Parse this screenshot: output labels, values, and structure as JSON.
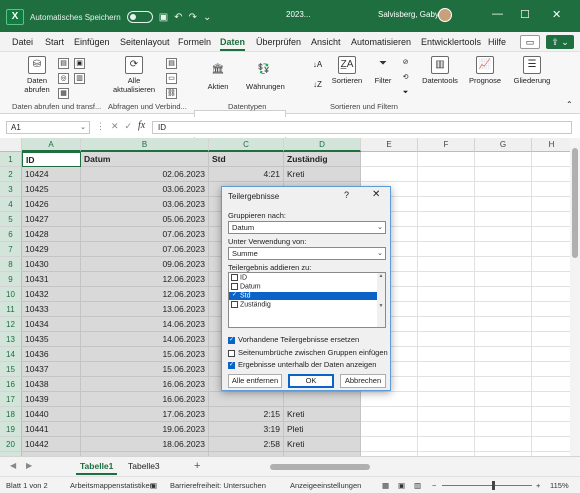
{
  "titlebar": {
    "autosave_label": "Automatisches Speichern",
    "doc_title": "2023...",
    "user_name": "Salvisberg, Gaby"
  },
  "menu": [
    "Datei",
    "Start",
    "Einfügen",
    "Seitenlayout",
    "Formeln",
    "Daten",
    "Überprüfen",
    "Ansicht",
    "Automatisieren",
    "Entwicklertools",
    "Hilfe"
  ],
  "menu_active": "Daten",
  "ribbon": {
    "daten_abrufen": "Daten abrufen",
    "alle_aktualisieren": "Alle aktualisieren",
    "aktien": "Aktien",
    "waehrungen": "Währungen",
    "sortieren": "Sortieren",
    "filter": "Filter",
    "datentools": "Datentools",
    "prognose": "Prognose",
    "gliederung": "Gliederung",
    "group_abrufen": "Daten abrufen und transf...",
    "group_abfragen": "Abfragen und Verbind...",
    "group_datentypen": "Datentypen",
    "group_sortieren": "Sortieren und Filtern"
  },
  "formula": {
    "namebox": "A1",
    "content": "ID"
  },
  "columns": [
    "A",
    "B",
    "C",
    "D",
    "E",
    "F",
    "G",
    "H"
  ],
  "rows": [
    {
      "n": "1",
      "id": "ID",
      "datum": "Datum",
      "std": "Std",
      "zust": "Zuständig"
    },
    {
      "n": "2",
      "id": "10424",
      "datum": "02.06.2023",
      "std": "4:21",
      "zust": "Kreti"
    },
    {
      "n": "3",
      "id": "10425",
      "datum": "03.06.2023",
      "std": "",
      "zust": ""
    },
    {
      "n": "4",
      "id": "10426",
      "datum": "03.06.2023",
      "std": "",
      "zust": ""
    },
    {
      "n": "5",
      "id": "10427",
      "datum": "05.06.2023",
      "std": "",
      "zust": ""
    },
    {
      "n": "6",
      "id": "10428",
      "datum": "07.06.2023",
      "std": "",
      "zust": ""
    },
    {
      "n": "7",
      "id": "10429",
      "datum": "07.06.2023",
      "std": "",
      "zust": ""
    },
    {
      "n": "8",
      "id": "10430",
      "datum": "09.06.2023",
      "std": "",
      "zust": ""
    },
    {
      "n": "9",
      "id": "10431",
      "datum": "12.06.2023",
      "std": "",
      "zust": ""
    },
    {
      "n": "10",
      "id": "10432",
      "datum": "12.06.2023",
      "std": "",
      "zust": ""
    },
    {
      "n": "11",
      "id": "10433",
      "datum": "13.06.2023",
      "std": "",
      "zust": ""
    },
    {
      "n": "12",
      "id": "10434",
      "datum": "14.06.2023",
      "std": "",
      "zust": ""
    },
    {
      "n": "13",
      "id": "10435",
      "datum": "14.06.2023",
      "std": "",
      "zust": ""
    },
    {
      "n": "14",
      "id": "10436",
      "datum": "15.06.2023",
      "std": "",
      "zust": ""
    },
    {
      "n": "15",
      "id": "10437",
      "datum": "15.06.2023",
      "std": "",
      "zust": ""
    },
    {
      "n": "16",
      "id": "10438",
      "datum": "16.06.2023",
      "std": "",
      "zust": ""
    },
    {
      "n": "17",
      "id": "10439",
      "datum": "16.06.2023",
      "std": "",
      "zust": ""
    },
    {
      "n": "18",
      "id": "10440",
      "datum": "17.06.2023",
      "std": "2:15",
      "zust": "Kreti"
    },
    {
      "n": "19",
      "id": "10441",
      "datum": "19.06.2023",
      "std": "3:19",
      "zust": "Pleti"
    },
    {
      "n": "20",
      "id": "10442",
      "datum": "18.06.2023",
      "std": "2:58",
      "zust": "Kreti"
    },
    {
      "n": "21",
      "id": "10443",
      "datum": "19.06.2023",
      "std": "3:42",
      "zust": "Pleti"
    }
  ],
  "sheets": [
    "Tabelle1",
    "Tabelle3"
  ],
  "status": {
    "blatt": "Blatt 1 von 2",
    "stats": "Arbeitsmappenstatistiken",
    "access": "Barrierefreiheit: Untersuchen",
    "display": "Anzeigeeinstellungen",
    "zoom": "115%"
  },
  "dialog": {
    "title": "Teilergebnisse",
    "help": "?",
    "group_label": "Gruppieren nach:",
    "group_value": "Datum",
    "func_label": "Unter Verwendung von:",
    "func_value": "Summe",
    "add_label": "Teilergebnis addieren zu:",
    "fields": [
      {
        "label": "ID",
        "checked": false,
        "selected": false
      },
      {
        "label": "Datum",
        "checked": false,
        "selected": false
      },
      {
        "label": "Std",
        "checked": true,
        "selected": true
      },
      {
        "label": "Zuständig",
        "checked": false,
        "selected": false
      }
    ],
    "opt_replace": "Vorhandene Teilergebnisse ersetzen",
    "opt_pagebreak": "Seitenumbrüche zwischen Gruppen einfügen",
    "opt_below": "Ergebnisse unterhalb der Daten anzeigen",
    "btn_remove": "Alle entfernen",
    "btn_ok": "OK",
    "btn_cancel": "Abbrechen"
  }
}
